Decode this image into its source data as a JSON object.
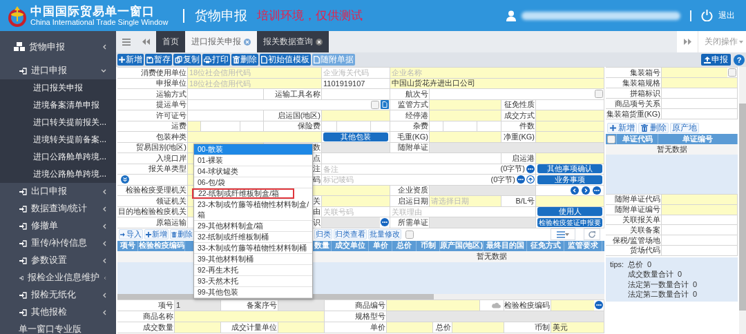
{
  "header": {
    "title": "中国国际贸易单一窗口",
    "subtitle": "China International Trade Single Window",
    "module": "货物申报",
    "notice": "培训环境，仅供测试",
    "logout": "退出"
  },
  "sidebar": {
    "section": "货物申报",
    "groups": [
      {
        "label": "进口申报",
        "expanded": true,
        "children": [
          "进口报关申报",
          "进境备案清单申报",
          "进口转关提前报关...",
          "进境转关提前备案...",
          "进口公路舱单跨境...",
          "进境公路舱单跨境..."
        ]
      },
      {
        "label": "出口申报",
        "expanded": false
      },
      {
        "label": "数据查询/统计",
        "expanded": false
      },
      {
        "label": "修撤单",
        "expanded": false
      },
      {
        "label": "重传/补传信息",
        "expanded": false
      },
      {
        "label": "参数设置",
        "expanded": false
      },
      {
        "label": "报检企业信息维护",
        "expanded": false
      },
      {
        "label": "报检无纸化",
        "expanded": false
      },
      {
        "label": "其他报检",
        "expanded": false
      }
    ],
    "footer": "单一窗口专业版"
  },
  "tabs": [
    {
      "label": "首页",
      "selected": false,
      "closable": false
    },
    {
      "label": "进口报关申报",
      "selected": true,
      "closable": true
    },
    {
      "label": "报关数据查询",
      "selected": false,
      "closable": true
    }
  ],
  "close_menu": "关闭操作",
  "toolbar": {
    "buttons": [
      {
        "label": "新增",
        "disabled": false
      },
      {
        "label": "暂存",
        "disabled": false
      },
      {
        "label": "复制",
        "disabled": false
      },
      {
        "label": "打印",
        "disabled": false
      },
      {
        "label": "删除",
        "disabled": false
      },
      {
        "label": "初始值模板",
        "disabled": false
      },
      {
        "label": "随附单据",
        "disabled": true
      }
    ],
    "submit": "申报",
    "help": "?"
  },
  "form": {
    "rows": [
      {
        "cells": [
          {
            "kind": "label",
            "text": "消费使用单位"
          },
          {
            "kind": "field",
            "colspan": 4,
            "required": true,
            "disabled": false,
            "placeholder": "18位社会信用代码"
          },
          {
            "kind": "field",
            "colspan": 3,
            "required": false,
            "disabled": false,
            "placeholder": "企业海关代码"
          },
          {
            "kind": "field",
            "colspan": 6,
            "required": true,
            "disabled": false,
            "placeholder": "企业名称"
          }
        ]
      },
      {
        "cells": [
          {
            "kind": "label",
            "text": "申报单位"
          },
          {
            "kind": "field",
            "colspan": 4,
            "required": true,
            "disabled": false,
            "placeholder": "18位社会信用代码"
          },
          {
            "kind": "field",
            "colspan": 3,
            "required": false,
            "disabled": false,
            "value": "1101919107"
          },
          {
            "kind": "field",
            "colspan": 6,
            "required": true,
            "disabled": false,
            "value": "中国山货花卉进出口公司"
          }
        ]
      },
      {
        "cells": [
          {
            "kind": "label",
            "text": "运输方式"
          },
          {
            "kind": "field",
            "colspan": 3,
            "required": false,
            "disabled": false
          },
          {
            "kind": "label",
            "text": "运输工具名称"
          },
          {
            "kind": "field",
            "colspan": 3,
            "required": false,
            "disabled": false
          },
          {
            "kind": "label",
            "text": "航次号"
          },
          {
            "kind": "field",
            "colspan": 5,
            "required": false,
            "disabled": false,
            "checked": false
          }
        ]
      },
      {
        "cells": [
          {
            "kind": "label",
            "text": "提运单号"
          },
          {
            "kind": "field",
            "colspan": 7,
            "required": false,
            "disabled": false,
            "checked": false
          },
          {
            "kind": "label",
            "text": "监管方式"
          },
          {
            "kind": "field",
            "colspan": 3,
            "required": true,
            "disabled": false
          },
          {
            "kind": "label",
            "text": "征免性质"
          },
          {
            "kind": "field",
            "required": false,
            "disabled": false
          }
        ]
      },
      {
        "cells": [
          {
            "kind": "label",
            "text": "许可证号"
          },
          {
            "kind": "field",
            "colspan": 3,
            "required": false,
            "disabled": false
          },
          {
            "kind": "label",
            "text": "启运国(地区)"
          },
          {
            "kind": "field",
            "colspan": 3,
            "required": true,
            "disabled": false
          },
          {
            "kind": "label",
            "text": "经停港"
          },
          {
            "kind": "field",
            "colspan": 3,
            "required": true,
            "disabled": false
          },
          {
            "kind": "label",
            "text": "成交方式"
          },
          {
            "kind": "field",
            "required": true,
            "disabled": false
          }
        ]
      },
      {
        "cells": [
          {
            "kind": "label",
            "text": "运费"
          },
          {
            "kind": "field",
            "required": true,
            "disabled": false
          },
          {
            "kind": "field",
            "required": false,
            "disabled": false
          },
          {
            "kind": "field",
            "required": false,
            "disabled": false
          },
          {
            "kind": "label",
            "text": "保险费"
          },
          {
            "kind": "field",
            "required": false,
            "disabled": false
          },
          {
            "kind": "field",
            "required": false,
            "disabled": false
          },
          {
            "kind": "field",
            "required": false,
            "disabled": false
          },
          {
            "kind": "label",
            "text": "杂费"
          },
          {
            "kind": "field",
            "required": false,
            "disabled": false
          },
          {
            "kind": "field",
            "required": false,
            "disabled": false
          },
          {
            "kind": "field",
            "required": false,
            "disabled": false
          },
          {
            "kind": "label",
            "text": "件数"
          },
          {
            "kind": "field",
            "required": true,
            "disabled": false
          }
        ]
      },
      {
        "cells": [
          {
            "kind": "label",
            "text": "包装种类"
          },
          {
            "kind": "field",
            "colspan": 4,
            "required": true,
            "disabled": false
          },
          {
            "kind": "button",
            "colspan": 3,
            "text": "其他包装"
          },
          {
            "kind": "label",
            "text": "毛重(KG)"
          },
          {
            "kind": "field",
            "colspan": 3,
            "required": true,
            "disabled": false
          },
          {
            "kind": "label",
            "text": "净重(KG)"
          },
          {
            "kind": "field",
            "required": true,
            "disabled": false
          }
        ]
      },
      {
        "cells": [
          {
            "kind": "label",
            "text": "贸易国别(地区)"
          },
          {
            "kind": "field",
            "colspan": 3,
            "required": true,
            "disabled": false
          },
          {
            "kind": "label",
            "text": "数"
          },
          {
            "kind": "field",
            "colspan": 3,
            "required": false,
            "disabled": true
          },
          {
            "kind": "label",
            "text": "随附单证"
          },
          {
            "kind": "field",
            "colspan": 5,
            "required": false,
            "disabled": true
          }
        ]
      },
      {
        "cells": [
          {
            "kind": "label",
            "text": "入境口岸"
          },
          {
            "kind": "field",
            "colspan": 3,
            "required": true,
            "disabled": false
          },
          {
            "kind": "label",
            "text": "点"
          },
          {
            "kind": "field",
            "colspan": 7,
            "required": false,
            "disabled": false
          },
          {
            "kind": "label",
            "text": "启运港"
          },
          {
            "kind": "field",
            "required": true,
            "disabled": false
          }
        ]
      },
      {
        "cells": [
          {
            "kind": "label",
            "text": "报关单类型"
          },
          {
            "kind": "field",
            "colspan": 3,
            "required": true,
            "disabled": false
          },
          {
            "kind": "label",
            "text": "注"
          },
          {
            "kind": "field",
            "colspan": 8,
            "required": false,
            "disabled": false,
            "placeholder": "备注",
            "note": "(0字节)"
          },
          {
            "kind": "button",
            "text": "其他事项确认"
          }
        ]
      },
      {
        "cells": [
          {
            "kind": "toggle"
          },
          {
            "kind": "field",
            "colspan": 3,
            "required": true,
            "disabled": false
          },
          {
            "kind": "label",
            "text": "码"
          },
          {
            "kind": "field",
            "colspan": 8,
            "required": false,
            "disabled": false,
            "placeholder": "标记唛码",
            "note": "(0字节)"
          },
          {
            "kind": "button",
            "text": "业务事项"
          }
        ]
      },
      {
        "cells": [
          {
            "kind": "label",
            "text": "检验检疫受理机关"
          },
          {
            "kind": "field",
            "colspan": 7,
            "required": true,
            "disabled": false
          },
          {
            "kind": "label",
            "text": "企业资质"
          },
          {
            "kind": "field",
            "colspan": 4,
            "required": false,
            "disabled": true
          },
          {
            "kind": "icons"
          }
        ]
      },
      {
        "cells": [
          {
            "kind": "label",
            "text": "领证机关"
          },
          {
            "kind": "field",
            "colspan": 3,
            "required": true,
            "disabled": false
          },
          {
            "kind": "label",
            "text": "关"
          },
          {
            "kind": "field",
            "colspan": 3,
            "required": true,
            "disabled": false
          },
          {
            "kind": "label",
            "text": "启运日期"
          },
          {
            "kind": "field",
            "colspan": 3,
            "required": true,
            "disabled": false,
            "placeholder": "请选择日期"
          },
          {
            "kind": "label",
            "text": "B/L号"
          },
          {
            "kind": "field",
            "required": true,
            "disabled": false
          }
        ]
      },
      {
        "cells": [
          {
            "kind": "label",
            "text": "目的地检验检疫机关"
          },
          {
            "kind": "field",
            "colspan": 3,
            "required": true,
            "disabled": false
          },
          {
            "kind": "label",
            "text": "由"
          },
          {
            "kind": "field",
            "colspan": 3,
            "required": false,
            "disabled": false,
            "placeholder": "关联号码"
          },
          {
            "kind": "field",
            "colspan": 5,
            "required": false,
            "disabled": false,
            "placeholder": "关联理由"
          },
          {
            "kind": "button",
            "text": "使用人"
          }
        ]
      },
      {
        "cells": [
          {
            "kind": "label",
            "text": "原箱运输"
          },
          {
            "kind": "field",
            "colspan": 3,
            "required": false,
            "disabled": false
          },
          {
            "kind": "label",
            "text": "识"
          },
          {
            "kind": "field",
            "colspan": 3,
            "required": false,
            "disabled": true
          },
          {
            "kind": "label",
            "text": "所需单证"
          },
          {
            "kind": "field",
            "colspan": 4,
            "required": false,
            "disabled": true
          },
          {
            "kind": "button",
            "text": "检验检疫签证申报要"
          }
        ]
      }
    ]
  },
  "goods": {
    "buttons": [
      "导入",
      "新增",
      "删除",
      "归类",
      "归类查看",
      "批量修改"
    ],
    "select_all": false,
    "columns": [
      "项号",
      "检验检疫编码",
      "数量",
      "成交单位",
      "单价",
      "总价",
      "币制",
      "原产国(地区)",
      "最终目的国",
      "征免方式",
      "监管要求"
    ],
    "empty": "暂无数据"
  },
  "detail": {
    "rows": [
      {
        "cells": [
          {
            "kind": "label",
            "text": "项号"
          },
          {
            "kind": "field",
            "required": false,
            "disabled": true,
            "value": "1"
          },
          {
            "kind": "label",
            "text": "备案序号"
          },
          {
            "kind": "field",
            "required": false,
            "disabled": true
          },
          {
            "kind": "label",
            "text": "商品编号"
          },
          {
            "kind": "field",
            "colspan": 3,
            "required": true,
            "disabled": false
          },
          {
            "kind": "icons"
          },
          {
            "kind": "label",
            "text": "检验检疫编码"
          },
          {
            "kind": "field",
            "required": true,
            "disabled": false
          }
        ]
      },
      {
        "cells": [
          {
            "kind": "label",
            "text": "商品名称"
          },
          {
            "kind": "field",
            "colspan": 3,
            "required": true,
            "disabled": false
          },
          {
            "kind": "label",
            "text": "规格型号"
          },
          {
            "kind": "field",
            "colspan": 6,
            "required": false,
            "disabled": true
          }
        ]
      },
      {
        "cells": [
          {
            "kind": "label",
            "text": "成交数量"
          },
          {
            "kind": "field",
            "required": true,
            "disabled": false
          },
          {
            "kind": "label",
            "text": "成交计量单位"
          },
          {
            "kind": "field",
            "required": true,
            "disabled": false
          },
          {
            "kind": "label",
            "text": "单价"
          },
          {
            "kind": "field",
            "required": true,
            "disabled": false
          },
          {
            "kind": "label",
            "text": "总价"
          },
          {
            "kind": "field",
            "colspan": 2,
            "required": true,
            "disabled": false
          },
          {
            "kind": "label",
            "text": "币制"
          },
          {
            "kind": "field",
            "required": true,
            "disabled": false,
            "value": "美元"
          }
        ]
      }
    ]
  },
  "container": {
    "rows": [
      {
        "label": "集装箱号",
        "required": true,
        "checked": false
      },
      {
        "label": "集装箱规格",
        "required": true
      },
      {
        "label": "拼箱标识",
        "required": false
      },
      {
        "label": "商品项号关系",
        "required": false
      },
      {
        "label": "集装箱货重(KG)",
        "required": false
      }
    ]
  },
  "documents": {
    "buttons": [
      "新增",
      "删除",
      "原产地"
    ],
    "select_all": false,
    "columns": [
      "单证代码",
      "单证编号"
    ],
    "empty": "暂无数据"
  },
  "extra": {
    "rows": [
      {
        "label": "随附单证代码",
        "required": true
      },
      {
        "label": "随附单证编号",
        "required": true
      },
      {
        "label": "关联报关单",
        "required": false
      },
      {
        "label": "关联备案",
        "required": false
      },
      {
        "label": "保税/监管场地",
        "required": false
      },
      {
        "label": "货场代码",
        "required": false
      }
    ]
  },
  "tips": {
    "label": "tips:",
    "lines": [
      {
        "name": "总价",
        "value": "0"
      },
      {
        "name": "成交数量合计",
        "value": "0"
      },
      {
        "name": "法定第一数量合计",
        "value": "0"
      },
      {
        "name": "法定第二数量合计",
        "value": "0"
      }
    ]
  },
  "package_dropdown": {
    "options": [
      {
        "label": "00-散装",
        "selected": true,
        "highlighted": false
      },
      {
        "label": "01-裸装",
        "selected": false,
        "highlighted": false
      },
      {
        "label": "04-球状罐类",
        "selected": false,
        "highlighted": false
      },
      {
        "label": "06-包/袋",
        "selected": false,
        "highlighted": false
      },
      {
        "label": "22-纸制或纤维板制盒/箱",
        "selected": false,
        "highlighted": true
      },
      {
        "label": "23-木制或竹藤等植物性材料制盒/箱",
        "selected": false,
        "highlighted": false
      },
      {
        "label": "29-其他材料制盒/箱",
        "selected": false,
        "highlighted": false
      },
      {
        "label": "32-纸制或纤维板制桶",
        "selected": false,
        "highlighted": false
      },
      {
        "label": "33-木制或竹藤等植物性材料制桶",
        "selected": false,
        "highlighted": false
      },
      {
        "label": "39-其他材料制桶",
        "selected": false,
        "highlighted": false
      },
      {
        "label": "92-再生木托",
        "selected": false,
        "highlighted": false
      },
      {
        "label": "93-天然木托",
        "selected": false,
        "highlighted": false
      },
      {
        "label": "99-其他包装",
        "selected": false,
        "highlighted": false
      }
    ]
  }
}
